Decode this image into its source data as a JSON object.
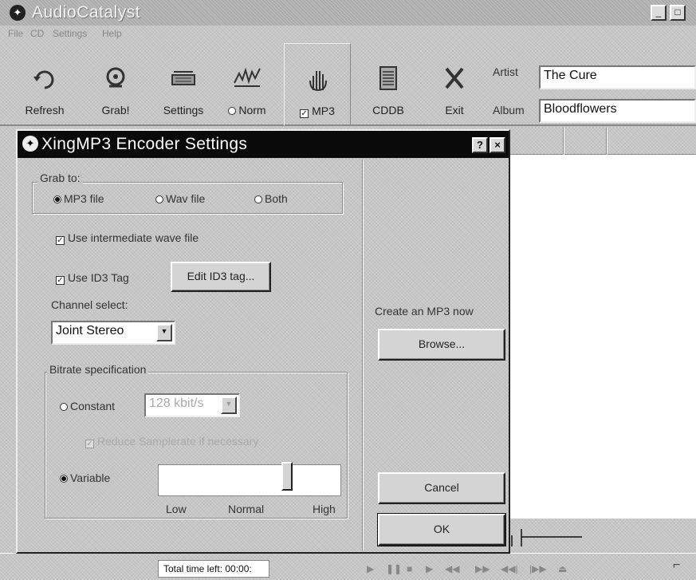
{
  "app": {
    "title": "AudioCatalyst"
  },
  "menu": [
    "File",
    "CD",
    "Settings",
    "Help"
  ],
  "toolbar": {
    "refresh": "Refresh",
    "grab": "Grab!",
    "settings": "Settings",
    "norm": "Norm",
    "mp3": "MP3",
    "cddb": "CDDB",
    "exit": "Exit"
  },
  "artist": {
    "label": "Artist",
    "value": "The Cure"
  },
  "album": {
    "label": "Album",
    "value": "Bloodflowers"
  },
  "status": {
    "time_left": "Total time left: 00:00:"
  },
  "dialog": {
    "title": "XingMP3 Encoder Settings",
    "grab_to": {
      "label": "Grab to:",
      "options": [
        "MP3 file",
        "Wav file",
        "Both"
      ],
      "selected": "MP3 file"
    },
    "use_intermediate": "Use intermediate wave file",
    "use_id3": "Use ID3 Tag",
    "edit_id3_button": "Edit ID3 tag...",
    "channel_select": {
      "label": "Channel select:",
      "value": "Joint Stereo"
    },
    "bitrate": {
      "label": "Bitrate specification",
      "constant_label": "Constant",
      "constant_value": "128 kbit/s",
      "reduce_samplerate": "Reduce Samplerate if necessary",
      "variable_label": "Variable",
      "slider_labels": [
        "Low",
        "Normal",
        "High"
      ],
      "slider_level": 0.72
    },
    "create_mp3_label": "Create an MP3 now",
    "browse_button": "Browse...",
    "cancel_button": "Cancel",
    "ok_button": "OK"
  }
}
